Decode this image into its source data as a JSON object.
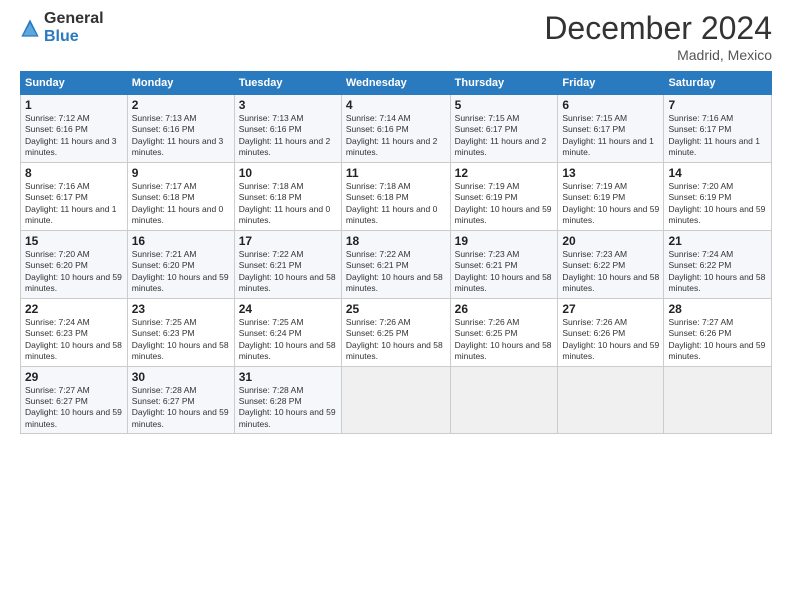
{
  "header": {
    "logo_general": "General",
    "logo_blue": "Blue",
    "title": "December 2024",
    "location": "Madrid, Mexico"
  },
  "weekdays": [
    "Sunday",
    "Monday",
    "Tuesday",
    "Wednesday",
    "Thursday",
    "Friday",
    "Saturday"
  ],
  "weeks": [
    [
      {
        "day": "1",
        "sunrise": "Sunrise: 7:12 AM",
        "sunset": "Sunset: 6:16 PM",
        "daylight": "Daylight: 11 hours and 3 minutes."
      },
      {
        "day": "2",
        "sunrise": "Sunrise: 7:13 AM",
        "sunset": "Sunset: 6:16 PM",
        "daylight": "Daylight: 11 hours and 3 minutes."
      },
      {
        "day": "3",
        "sunrise": "Sunrise: 7:13 AM",
        "sunset": "Sunset: 6:16 PM",
        "daylight": "Daylight: 11 hours and 2 minutes."
      },
      {
        "day": "4",
        "sunrise": "Sunrise: 7:14 AM",
        "sunset": "Sunset: 6:16 PM",
        "daylight": "Daylight: 11 hours and 2 minutes."
      },
      {
        "day": "5",
        "sunrise": "Sunrise: 7:15 AM",
        "sunset": "Sunset: 6:17 PM",
        "daylight": "Daylight: 11 hours and 2 minutes."
      },
      {
        "day": "6",
        "sunrise": "Sunrise: 7:15 AM",
        "sunset": "Sunset: 6:17 PM",
        "daylight": "Daylight: 11 hours and 1 minute."
      },
      {
        "day": "7",
        "sunrise": "Sunrise: 7:16 AM",
        "sunset": "Sunset: 6:17 PM",
        "daylight": "Daylight: 11 hours and 1 minute."
      }
    ],
    [
      {
        "day": "8",
        "sunrise": "Sunrise: 7:16 AM",
        "sunset": "Sunset: 6:17 PM",
        "daylight": "Daylight: 11 hours and 1 minute."
      },
      {
        "day": "9",
        "sunrise": "Sunrise: 7:17 AM",
        "sunset": "Sunset: 6:18 PM",
        "daylight": "Daylight: 11 hours and 0 minutes."
      },
      {
        "day": "10",
        "sunrise": "Sunrise: 7:18 AM",
        "sunset": "Sunset: 6:18 PM",
        "daylight": "Daylight: 11 hours and 0 minutes."
      },
      {
        "day": "11",
        "sunrise": "Sunrise: 7:18 AM",
        "sunset": "Sunset: 6:18 PM",
        "daylight": "Daylight: 11 hours and 0 minutes."
      },
      {
        "day": "12",
        "sunrise": "Sunrise: 7:19 AM",
        "sunset": "Sunset: 6:19 PM",
        "daylight": "Daylight: 10 hours and 59 minutes."
      },
      {
        "day": "13",
        "sunrise": "Sunrise: 7:19 AM",
        "sunset": "Sunset: 6:19 PM",
        "daylight": "Daylight: 10 hours and 59 minutes."
      },
      {
        "day": "14",
        "sunrise": "Sunrise: 7:20 AM",
        "sunset": "Sunset: 6:19 PM",
        "daylight": "Daylight: 10 hours and 59 minutes."
      }
    ],
    [
      {
        "day": "15",
        "sunrise": "Sunrise: 7:20 AM",
        "sunset": "Sunset: 6:20 PM",
        "daylight": "Daylight: 10 hours and 59 minutes."
      },
      {
        "day": "16",
        "sunrise": "Sunrise: 7:21 AM",
        "sunset": "Sunset: 6:20 PM",
        "daylight": "Daylight: 10 hours and 59 minutes."
      },
      {
        "day": "17",
        "sunrise": "Sunrise: 7:22 AM",
        "sunset": "Sunset: 6:21 PM",
        "daylight": "Daylight: 10 hours and 58 minutes."
      },
      {
        "day": "18",
        "sunrise": "Sunrise: 7:22 AM",
        "sunset": "Sunset: 6:21 PM",
        "daylight": "Daylight: 10 hours and 58 minutes."
      },
      {
        "day": "19",
        "sunrise": "Sunrise: 7:23 AM",
        "sunset": "Sunset: 6:21 PM",
        "daylight": "Daylight: 10 hours and 58 minutes."
      },
      {
        "day": "20",
        "sunrise": "Sunrise: 7:23 AM",
        "sunset": "Sunset: 6:22 PM",
        "daylight": "Daylight: 10 hours and 58 minutes."
      },
      {
        "day": "21",
        "sunrise": "Sunrise: 7:24 AM",
        "sunset": "Sunset: 6:22 PM",
        "daylight": "Daylight: 10 hours and 58 minutes."
      }
    ],
    [
      {
        "day": "22",
        "sunrise": "Sunrise: 7:24 AM",
        "sunset": "Sunset: 6:23 PM",
        "daylight": "Daylight: 10 hours and 58 minutes."
      },
      {
        "day": "23",
        "sunrise": "Sunrise: 7:25 AM",
        "sunset": "Sunset: 6:23 PM",
        "daylight": "Daylight: 10 hours and 58 minutes."
      },
      {
        "day": "24",
        "sunrise": "Sunrise: 7:25 AM",
        "sunset": "Sunset: 6:24 PM",
        "daylight": "Daylight: 10 hours and 58 minutes."
      },
      {
        "day": "25",
        "sunrise": "Sunrise: 7:26 AM",
        "sunset": "Sunset: 6:25 PM",
        "daylight": "Daylight: 10 hours and 58 minutes."
      },
      {
        "day": "26",
        "sunrise": "Sunrise: 7:26 AM",
        "sunset": "Sunset: 6:25 PM",
        "daylight": "Daylight: 10 hours and 58 minutes."
      },
      {
        "day": "27",
        "sunrise": "Sunrise: 7:26 AM",
        "sunset": "Sunset: 6:26 PM",
        "daylight": "Daylight: 10 hours and 59 minutes."
      },
      {
        "day": "28",
        "sunrise": "Sunrise: 7:27 AM",
        "sunset": "Sunset: 6:26 PM",
        "daylight": "Daylight: 10 hours and 59 minutes."
      }
    ],
    [
      {
        "day": "29",
        "sunrise": "Sunrise: 7:27 AM",
        "sunset": "Sunset: 6:27 PM",
        "daylight": "Daylight: 10 hours and 59 minutes."
      },
      {
        "day": "30",
        "sunrise": "Sunrise: 7:28 AM",
        "sunset": "Sunset: 6:27 PM",
        "daylight": "Daylight: 10 hours and 59 minutes."
      },
      {
        "day": "31",
        "sunrise": "Sunrise: 7:28 AM",
        "sunset": "Sunset: 6:28 PM",
        "daylight": "Daylight: 10 hours and 59 minutes."
      },
      null,
      null,
      null,
      null
    ]
  ]
}
